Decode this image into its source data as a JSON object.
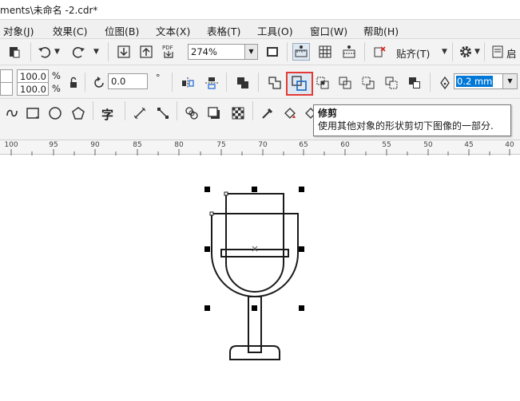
{
  "window": {
    "title": "ments\\未命名 -2.cdr*"
  },
  "menu": [
    "对象(J)",
    "效果(C)",
    "位图(B)",
    "文本(X)",
    "表格(T)",
    "工具(O)",
    "窗口(W)",
    "帮助(H)"
  ],
  "standard_toolbar": {
    "zoom_value": "274%",
    "snap_label": "贴齐(T)",
    "pdf_label": "PDF",
    "launch_label": "启"
  },
  "property_bar": {
    "scale_x": "100.0",
    "scale_y": "100.0",
    "percent_1": "%",
    "percent_2": "%",
    "rotation": "0.0",
    "degree_symbol": "°",
    "outline_width": "0.2 mm"
  },
  "toolbox": {
    "text_tool_glyph": "字"
  },
  "tooltip": {
    "title": "修剪",
    "description": "使用其他对象的形状剪切下图像的一部分."
  },
  "ruler": {
    "labels": [
      "100",
      "95",
      "90",
      "85",
      "80",
      "75",
      "70",
      "65",
      "60",
      "55",
      "50",
      "45",
      "40"
    ]
  },
  "colors": {
    "highlight_border": "#e53935",
    "selected_text_bg": "#0078d7",
    "toolbar_bg": "#f3f3f3"
  }
}
